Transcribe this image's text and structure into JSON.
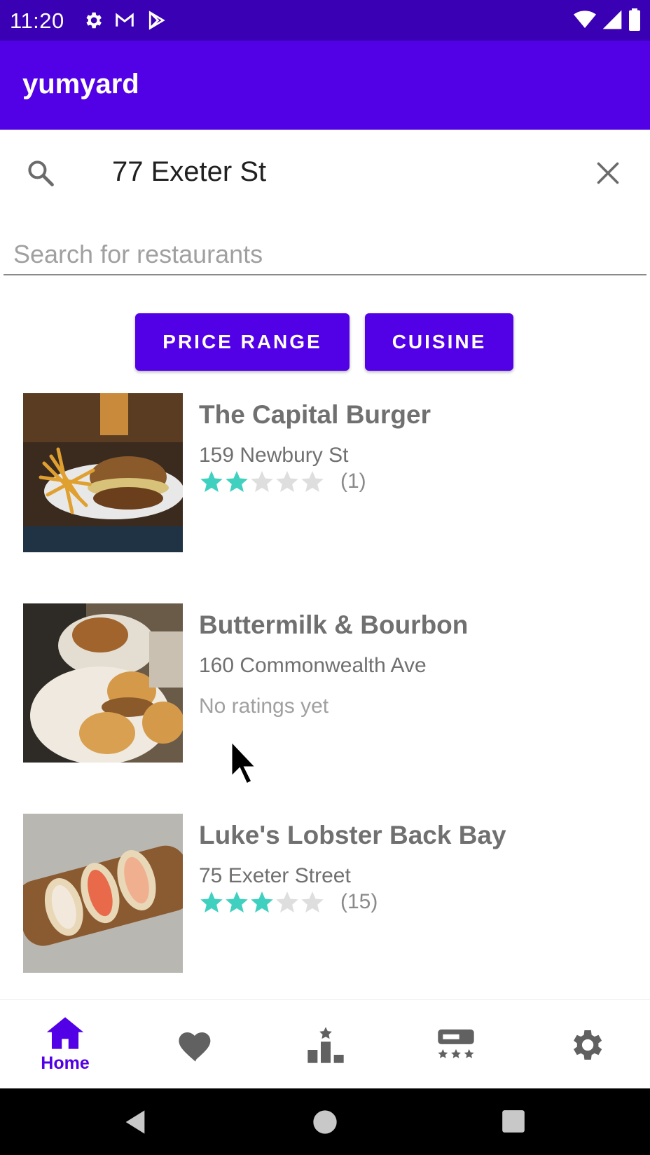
{
  "status_bar": {
    "time": "11:20",
    "left_icons": [
      "settings-icon",
      "gmail-icon",
      "play-store-icon"
    ],
    "right_icons": [
      "wifi-icon",
      "cell-signal-icon",
      "battery-icon"
    ]
  },
  "app_bar": {
    "title": "yumyard"
  },
  "address": {
    "value": "77 Exeter St",
    "search_icon": "search-icon",
    "clear_icon": "close-icon"
  },
  "search": {
    "placeholder": "Search for restaurants",
    "value": ""
  },
  "filters": {
    "price_range": "PRICE RANGE",
    "cuisine": "CUISINE"
  },
  "restaurants": [
    {
      "name": "The Capital Burger",
      "address": "159 Newbury St",
      "rating": 2,
      "max_rating": 5,
      "count": "(1)"
    },
    {
      "name": "Buttermilk & Bourbon",
      "address": "160 Commonwealth Ave",
      "rating": null,
      "no_rating_text": "No ratings yet"
    },
    {
      "name": "Luke's Lobster Back Bay",
      "address": "75 Exeter Street",
      "rating": 3,
      "max_rating": 5,
      "count": "(15)"
    }
  ],
  "bottom_nav": {
    "items": [
      {
        "icon": "home-icon",
        "label": "Home",
        "active": true
      },
      {
        "icon": "heart-icon",
        "label": "",
        "active": false
      },
      {
        "icon": "leaderboard-icon",
        "label": "",
        "active": false
      },
      {
        "icon": "reviews-icon",
        "label": "",
        "active": false
      },
      {
        "icon": "settings-icon",
        "label": "",
        "active": false
      }
    ]
  },
  "colors": {
    "primary": "#5200e6",
    "status_bar": "#3a00b3",
    "star_filled": "#3fd0c0",
    "star_empty": "#dedede",
    "inactive_icon": "#616161"
  }
}
